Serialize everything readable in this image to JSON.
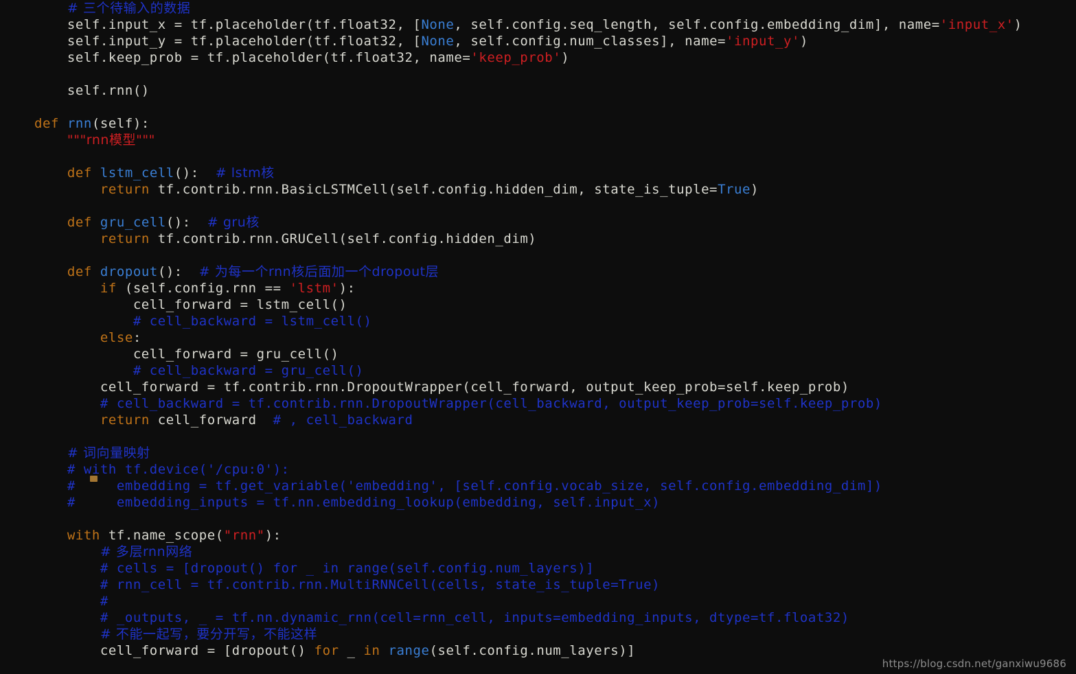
{
  "editor": {
    "background_color": "#0d0d0d",
    "default_text_color": "#d9d9d1",
    "keyword_color": "#c07318",
    "function_color": "#3a7fd5",
    "comment_color": "#1f33c8",
    "string_color": "#cf1f22",
    "language": "python",
    "font_size_px": 19,
    "line_height_px": 24
  },
  "watermark": {
    "text": "https://blog.csdn.net/ganxiwu9686"
  },
  "code": {
    "lines": [
      {
        "id": 1,
        "tokens": [
          {
            "t": "        ",
            "c": "txt"
          },
          {
            "t": "# 三个待输入的数据",
            "c": "cmt"
          }
        ]
      },
      {
        "id": 2,
        "tokens": [
          {
            "t": "        self.input_x = tf.placeholder(tf.float32, [",
            "c": "txt"
          },
          {
            "t": "None",
            "c": "lit"
          },
          {
            "t": ", self.config.seq_length, self.config.embedding_dim], name=",
            "c": "txt"
          },
          {
            "t": "'input_x'",
            "c": "str"
          },
          {
            "t": ")",
            "c": "txt"
          }
        ]
      },
      {
        "id": 3,
        "tokens": [
          {
            "t": "        self.input_y = tf.placeholder(tf.float32, [",
            "c": "txt"
          },
          {
            "t": "None",
            "c": "lit"
          },
          {
            "t": ", self.config.num_classes], name=",
            "c": "txt"
          },
          {
            "t": "'input_y'",
            "c": "str"
          },
          {
            "t": ")",
            "c": "txt"
          }
        ]
      },
      {
        "id": 4,
        "tokens": [
          {
            "t": "        self.keep_prob = tf.placeholder(tf.float32, name=",
            "c": "txt"
          },
          {
            "t": "'keep_prob'",
            "c": "str"
          },
          {
            "t": ")",
            "c": "txt"
          }
        ]
      },
      {
        "id": 5,
        "tokens": []
      },
      {
        "id": 6,
        "tokens": [
          {
            "t": "        self.rnn()",
            "c": "txt"
          }
        ]
      },
      {
        "id": 7,
        "tokens": []
      },
      {
        "id": 8,
        "tokens": [
          {
            "t": "    ",
            "c": "txt"
          },
          {
            "t": "def",
            "c": "def"
          },
          {
            "t": " ",
            "c": "txt"
          },
          {
            "t": "rnn",
            "c": "fn"
          },
          {
            "t": "(self):",
            "c": "txt"
          }
        ]
      },
      {
        "id": 9,
        "tokens": [
          {
            "t": "        ",
            "c": "txt"
          },
          {
            "t": "\"\"\"rnn模型\"\"\"",
            "c": "str"
          }
        ]
      },
      {
        "id": 10,
        "tokens": []
      },
      {
        "id": 11,
        "tokens": [
          {
            "t": "        ",
            "c": "txt"
          },
          {
            "t": "def",
            "c": "def"
          },
          {
            "t": " ",
            "c": "txt"
          },
          {
            "t": "lstm_cell",
            "c": "fn"
          },
          {
            "t": "():  ",
            "c": "txt"
          },
          {
            "t": "# lstm核",
            "c": "cmt"
          }
        ]
      },
      {
        "id": 12,
        "tokens": [
          {
            "t": "            ",
            "c": "txt"
          },
          {
            "t": "return",
            "c": "kw"
          },
          {
            "t": " tf.contrib.rnn.BasicLSTMCell(self.config.hidden_dim, state_is_tuple=",
            "c": "txt"
          },
          {
            "t": "True",
            "c": "lit"
          },
          {
            "t": ")",
            "c": "txt"
          }
        ]
      },
      {
        "id": 13,
        "tokens": []
      },
      {
        "id": 14,
        "tokens": [
          {
            "t": "        ",
            "c": "txt"
          },
          {
            "t": "def",
            "c": "def"
          },
          {
            "t": " ",
            "c": "txt"
          },
          {
            "t": "gru_cell",
            "c": "fn"
          },
          {
            "t": "():  ",
            "c": "txt"
          },
          {
            "t": "# gru核",
            "c": "cmt"
          }
        ]
      },
      {
        "id": 15,
        "tokens": [
          {
            "t": "            ",
            "c": "txt"
          },
          {
            "t": "return",
            "c": "kw"
          },
          {
            "t": " tf.contrib.rnn.GRUCell(self.config.hidden_dim)",
            "c": "txt"
          }
        ]
      },
      {
        "id": 16,
        "tokens": []
      },
      {
        "id": 17,
        "tokens": [
          {
            "t": "        ",
            "c": "txt"
          },
          {
            "t": "def",
            "c": "def"
          },
          {
            "t": " ",
            "c": "txt"
          },
          {
            "t": "dropout",
            "c": "fn"
          },
          {
            "t": "():  ",
            "c": "txt"
          },
          {
            "t": "# 为每一个rnn核后面加一个dropout层",
            "c": "cmt"
          }
        ]
      },
      {
        "id": 18,
        "tokens": [
          {
            "t": "            ",
            "c": "txt"
          },
          {
            "t": "if",
            "c": "kw"
          },
          {
            "t": " (self.config.rnn == ",
            "c": "txt"
          },
          {
            "t": "'lstm'",
            "c": "str"
          },
          {
            "t": "):",
            "c": "txt"
          }
        ]
      },
      {
        "id": 19,
        "tokens": [
          {
            "t": "                cell_forward = lstm_cell()",
            "c": "txt"
          }
        ]
      },
      {
        "id": 20,
        "tokens": [
          {
            "t": "                ",
            "c": "txt"
          },
          {
            "t": "# cell_backward = lstm_cell()",
            "c": "cmt"
          }
        ]
      },
      {
        "id": 21,
        "tokens": [
          {
            "t": "            ",
            "c": "txt"
          },
          {
            "t": "else",
            "c": "kw"
          },
          {
            "t": ":",
            "c": "txt"
          }
        ]
      },
      {
        "id": 22,
        "tokens": [
          {
            "t": "                cell_forward = gru_cell()",
            "c": "txt"
          }
        ]
      },
      {
        "id": 23,
        "tokens": [
          {
            "t": "                ",
            "c": "txt"
          },
          {
            "t": "# cell_backward = gru_cell()",
            "c": "cmt"
          }
        ]
      },
      {
        "id": 24,
        "tokens": [
          {
            "t": "            cell_forward = tf.contrib.rnn.DropoutWrapper(cell_forward, output_keep_prob=self.keep_prob)",
            "c": "txt"
          }
        ]
      },
      {
        "id": 25,
        "tokens": [
          {
            "t": "            ",
            "c": "txt"
          },
          {
            "t": "# cell_backward = tf.contrib.rnn.DropoutWrapper(cell_backward, output_keep_prob=self.keep_prob)",
            "c": "cmt"
          }
        ]
      },
      {
        "id": 26,
        "tokens": [
          {
            "t": "            ",
            "c": "txt"
          },
          {
            "t": "return",
            "c": "kw"
          },
          {
            "t": " cell_forward  ",
            "c": "txt"
          },
          {
            "t": "# , cell_backward",
            "c": "cmt"
          }
        ]
      },
      {
        "id": 27,
        "tokens": []
      },
      {
        "id": 28,
        "tokens": [
          {
            "t": "        ",
            "c": "txt"
          },
          {
            "t": "# 词向量映射",
            "c": "cmt"
          }
        ]
      },
      {
        "id": 29,
        "tokens": [
          {
            "t": "        ",
            "c": "txt"
          },
          {
            "t": "# with tf.device('/cpu:0'):",
            "c": "cmt"
          }
        ]
      },
      {
        "id": 30,
        "tokens": [
          {
            "t": "        ",
            "c": "txt"
          },
          {
            "t": "#     embedding = tf.get_variable('embedding', [self.config.vocab_size, self.config.embedding_dim])",
            "c": "cmt"
          }
        ]
      },
      {
        "id": 31,
        "tokens": [
          {
            "t": "        ",
            "c": "txt"
          },
          {
            "t": "#     embedding_inputs = tf.nn.embedding_lookup(embedding, self.input_x)",
            "c": "cmt"
          }
        ]
      },
      {
        "id": 32,
        "tokens": []
      },
      {
        "id": 33,
        "tokens": [
          {
            "t": "        ",
            "c": "txt"
          },
          {
            "t": "with",
            "c": "kw"
          },
          {
            "t": " tf.name_scope(",
            "c": "txt"
          },
          {
            "t": "\"rnn\"",
            "c": "str"
          },
          {
            "t": "):",
            "c": "txt"
          }
        ]
      },
      {
        "id": 34,
        "tokens": [
          {
            "t": "            ",
            "c": "txt"
          },
          {
            "t": "# 多层rnn网络",
            "c": "cmt"
          }
        ]
      },
      {
        "id": 35,
        "tokens": [
          {
            "t": "            ",
            "c": "txt"
          },
          {
            "t": "# cells = [dropout() for _ in range(self.config.num_layers)]",
            "c": "cmt"
          }
        ]
      },
      {
        "id": 36,
        "tokens": [
          {
            "t": "            ",
            "c": "txt"
          },
          {
            "t": "# rnn_cell = tf.contrib.rnn.MultiRNNCell(cells, state_is_tuple=True)",
            "c": "cmt"
          }
        ]
      },
      {
        "id": 37,
        "tokens": [
          {
            "t": "            ",
            "c": "txt"
          },
          {
            "t": "#",
            "c": "cmt"
          }
        ]
      },
      {
        "id": 38,
        "tokens": [
          {
            "t": "            ",
            "c": "txt"
          },
          {
            "t": "# _outputs, _ = tf.nn.dynamic_rnn(cell=rnn_cell, inputs=embedding_inputs, dtype=tf.float32)",
            "c": "cmt"
          }
        ]
      },
      {
        "id": 39,
        "tokens": [
          {
            "t": "            ",
            "c": "txt"
          },
          {
            "t": "# 不能一起写，要分开写，不能这样",
            "c": "cmt"
          }
        ]
      },
      {
        "id": 40,
        "tokens": [
          {
            "t": "            cell_forward = [dropout() ",
            "c": "txt"
          },
          {
            "t": "for",
            "c": "kw"
          },
          {
            "t": " _ ",
            "c": "txt"
          },
          {
            "t": "in",
            "c": "kw"
          },
          {
            "t": " ",
            "c": "txt"
          },
          {
            "t": "range",
            "c": "fn"
          },
          {
            "t": "(self.config.num_layers)]",
            "c": "txt"
          }
        ]
      }
    ]
  }
}
